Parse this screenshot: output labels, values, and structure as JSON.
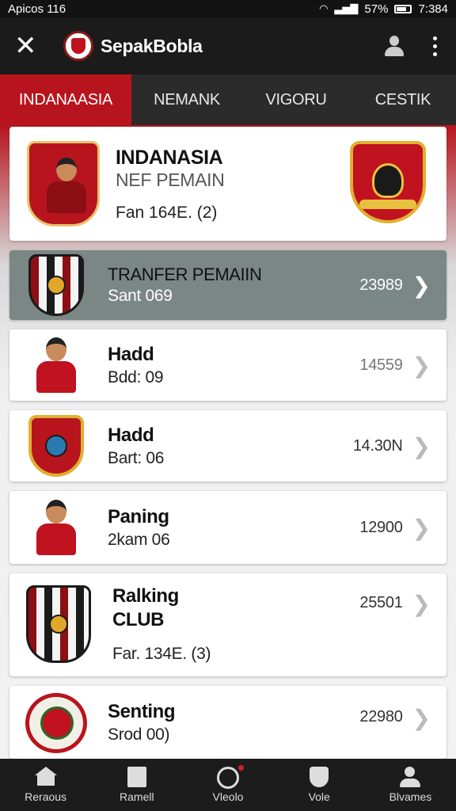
{
  "status_bar": {
    "left_text": "Apicos 116",
    "battery": "57%",
    "time": "7:384"
  },
  "app_bar": {
    "title": "SepakBobla"
  },
  "tabs": [
    {
      "label": "INDANAASIA",
      "active": true
    },
    {
      "label": "NEMANK",
      "active": false
    },
    {
      "label": "VIGORU",
      "active": false
    },
    {
      "label": "CESTIK",
      "active": false
    }
  ],
  "featured": {
    "title": "INDANASIA",
    "subtitle": "NEF PEMAIN",
    "meta": "Fan 164E. (2)"
  },
  "list": [
    {
      "title": "TRANFER PEMAIIN",
      "subtitle": "Sant 069",
      "value": "23989",
      "highlighted": true
    },
    {
      "title": "Hadd",
      "subtitle": "Bdd: 09",
      "value": "14559",
      "highlighted": false
    },
    {
      "title": "Hadd",
      "subtitle": "Bart: 06",
      "value": "14.30N",
      "highlighted": false
    },
    {
      "title": "Paning",
      "subtitle": "2kam 06",
      "value": "12900",
      "highlighted": false
    },
    {
      "title": "Ralking CLUB",
      "subtitle": "Far. 134E. (3)",
      "value": "25501",
      "highlighted": false
    },
    {
      "title": "Senting",
      "subtitle": "Srod 00)",
      "value": "22980",
      "highlighted": false
    }
  ],
  "bottom_nav": [
    {
      "label": "Reraous",
      "icon": "home-icon"
    },
    {
      "label": "Ramell",
      "icon": "document-icon"
    },
    {
      "label": "Vleolo",
      "icon": "clock-icon"
    },
    {
      "label": "Vole",
      "icon": "shield-icon"
    },
    {
      "label": "Blvames",
      "icon": "user-icon"
    }
  ],
  "colors": {
    "accent": "#b8141e",
    "highlight_row": "#7a8784",
    "app_bar": "#1b1b1b"
  }
}
